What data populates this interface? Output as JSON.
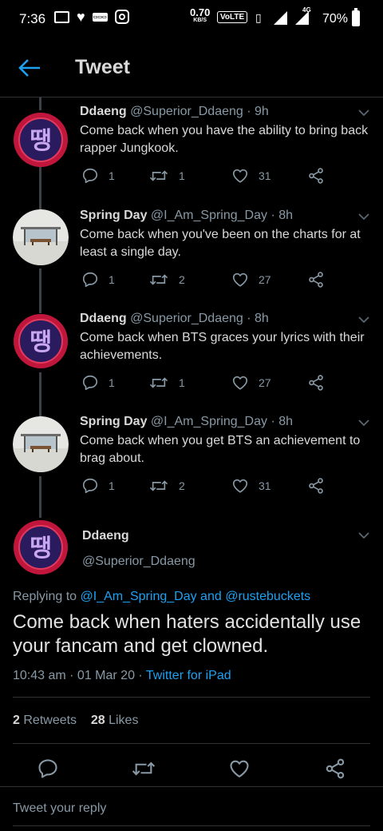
{
  "status_bar": {
    "time": "7:36",
    "speed_value": "0.70",
    "speed_unit": "KB/S",
    "volte": "VoLTE",
    "network": "4G",
    "battery": "70%"
  },
  "header": {
    "title": "Tweet"
  },
  "tweets": [
    {
      "name": "Ddaeng",
      "handle": "@Superior_Ddaeng",
      "time": "· 9h",
      "text": "Come back when you have the ability to bring back rapper Jungkook.",
      "replies": "1",
      "retweets": "1",
      "likes": "31",
      "avatar": "ddaeng-avatar"
    },
    {
      "name": "Spring Day",
      "handle": "@I_Am_Spring_Day",
      "time": "· 8h",
      "text": "Come back when you've been on the charts for at least a single day.",
      "replies": "1",
      "retweets": "2",
      "likes": "27",
      "avatar": "spring-day-avatar"
    },
    {
      "name": "Ddaeng",
      "handle": "@Superior_Ddaeng",
      "time": "· 8h",
      "text": "Come back when BTS graces your lyrics with their achievements.",
      "replies": "1",
      "retweets": "1",
      "likes": "27",
      "avatar": "ddaeng-avatar"
    },
    {
      "name": "Spring Day",
      "handle": "@I_Am_Spring_Day",
      "time": "· 8h",
      "text": "Come back when you get BTS an achievement to brag about.",
      "replies": "1",
      "retweets": "2",
      "likes": "31",
      "avatar": "spring-day-avatar"
    }
  ],
  "main_tweet": {
    "name": "Ddaeng",
    "handle": "@Superior_Ddaeng",
    "replying_prefix": "Replying to",
    "replying_user1": "@I_Am_Spring_Day",
    "replying_and": "and",
    "replying_user2": "@rustebuckets",
    "text": "Come back when haters accidentally use your fancam and get clowned.",
    "timestamp": "10:43 am · 01 Mar 20 ·",
    "source": "Twitter for iPad",
    "retweet_count": "2",
    "retweet_label": "Retweets",
    "like_count": "28",
    "like_label": "Likes"
  },
  "reply": {
    "placeholder": "Tweet your reply"
  },
  "colors": {
    "accent": "#1da1f2",
    "muted": "#8899a6",
    "background": "#000000"
  },
  "avatar_glyph": "땡"
}
